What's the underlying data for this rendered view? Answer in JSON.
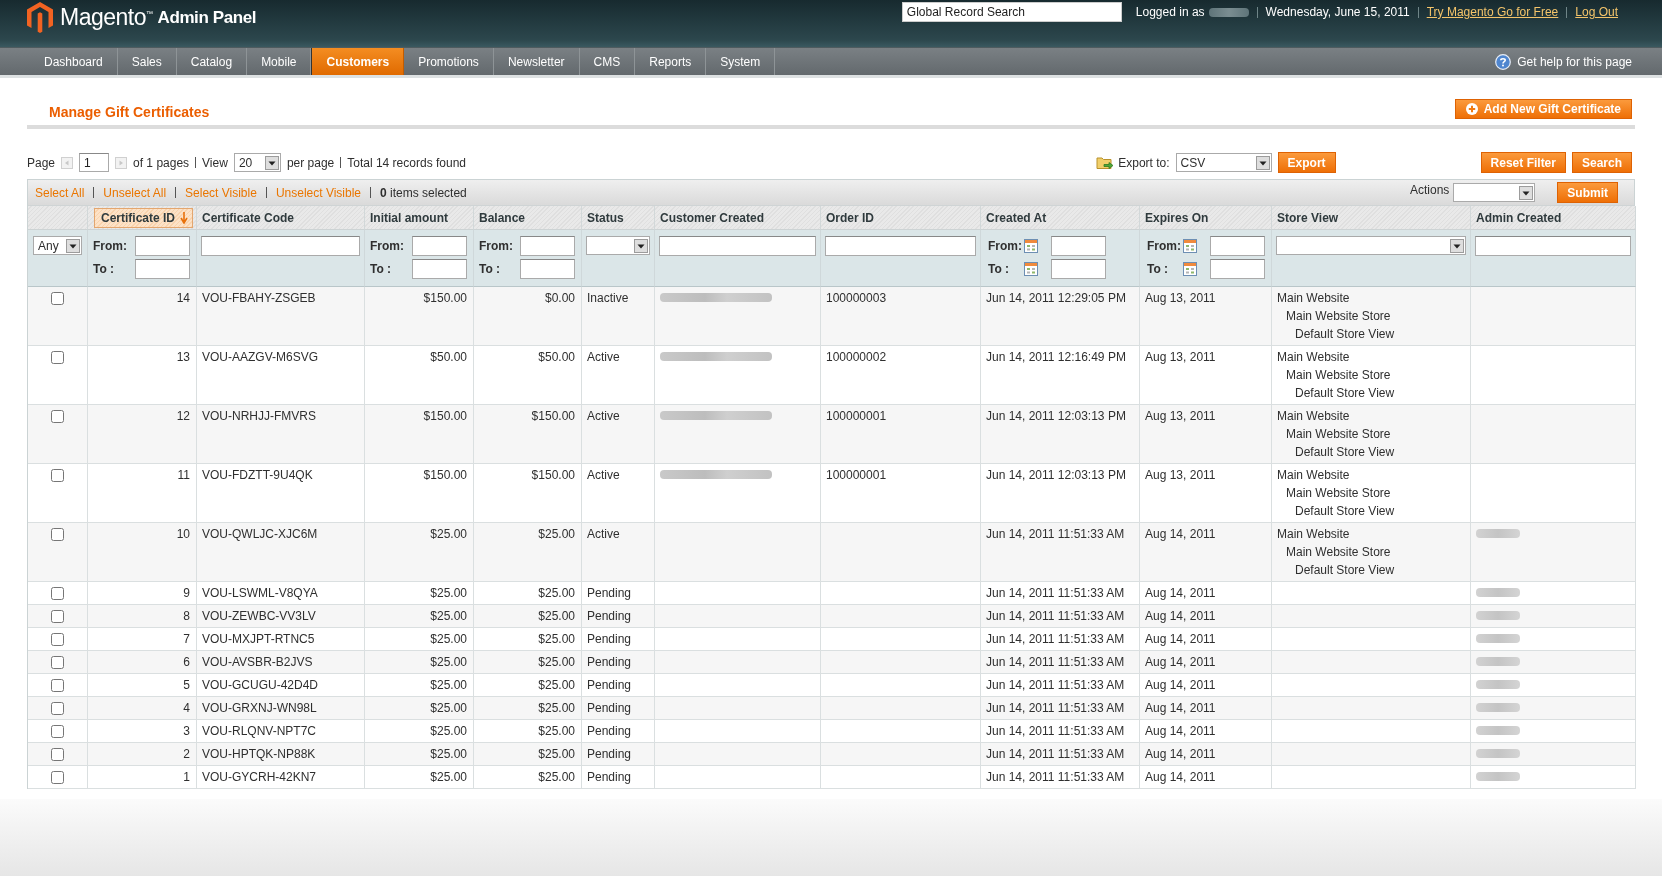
{
  "header": {
    "logo": "Magento$^{™}$",
    "subtitle": "Admin Panel",
    "search": {
      "value": "Global Record Search"
    },
    "logged_in_label": "Logged in as",
    "user_blurred": true,
    "date": "Wednesday, June 15, 2011",
    "links": [
      "Try Magento Go for Free",
      "Log Out"
    ]
  },
  "nav": {
    "items": [
      {
        "label": "Dashboard",
        "selected": false
      },
      {
        "label": "Sales",
        "selected": false
      },
      {
        "label": "Catalog",
        "selected": false
      },
      {
        "label": "Mobile",
        "selected": false
      },
      {
        "label": "Customers",
        "selected": true
      },
      {
        "label": "Promotions",
        "selected": false
      },
      {
        "label": "Newsletter",
        "selected": false
      },
      {
        "label": "CMS",
        "selected": false
      },
      {
        "label": "Reports",
        "selected": false
      },
      {
        "label": "System",
        "selected": false
      }
    ],
    "help": "Get help for this page"
  },
  "page": {
    "title": "Manage Gift Certificates",
    "add_button": "Add New Gift Certificate"
  },
  "pager": {
    "page_label": "Page",
    "page": "1",
    "of_pages": "of 1 pages",
    "view_label": "View",
    "per_page": "20",
    "per_page_label": "per page",
    "total": "Total 14 records found"
  },
  "export": {
    "label": "Export to:",
    "format": "CSV",
    "button": "Export"
  },
  "filter_buttons": [
    "Reset Filter",
    "Search"
  ],
  "massaction": {
    "links": [
      "Select All",
      "Unselect All",
      "Select Visible",
      "Unselect Visible"
    ],
    "count": "**0** items selected",
    "actions_label": "Actions",
    "submit": "Submit"
  },
  "table": {
    "columns": [
      {
        "filter": {
          "kind": "select",
          "value": "Any"
        }
      },
      {
        "label": "Certificate ID",
        "sorted": true,
        "filter": {
          "kind": "range",
          "from_label": "From:",
          "to_label": "To :"
        }
      },
      {
        "label": "Certificate Code",
        "sorted": false,
        "filter": {
          "kind": "text"
        }
      },
      {
        "label": "Initial amount",
        "sorted": false,
        "filter": {
          "kind": "range",
          "from_label": "From:",
          "to_label": "To :"
        }
      },
      {
        "label": "Balance",
        "sorted": false,
        "filter": {
          "kind": "range",
          "from_label": "From:",
          "to_label": "To :"
        }
      },
      {
        "label": "Status",
        "sorted": false,
        "filter": {
          "kind": "select"
        }
      },
      {
        "label": "Customer Created",
        "sorted": false,
        "filter": {
          "kind": "text"
        }
      },
      {
        "label": "Order ID",
        "sorted": false,
        "filter": {
          "kind": "text"
        }
      },
      {
        "label": "Created At",
        "sorted": false,
        "filter": {
          "kind": "date_range",
          "from_label": "From:",
          "to_label": "To :"
        }
      },
      {
        "label": "Expires On",
        "sorted": false,
        "filter": {
          "kind": "date_range",
          "from_label": "From:",
          "to_label": "To :"
        }
      },
      {
        "label": "Store View",
        "sorted": false,
        "filter": {
          "kind": "select"
        }
      },
      {
        "label": "Admin Created",
        "sorted": false,
        "filter": {
          "kind": "text"
        }
      }
    ],
    "rows": [
      {
        "checked": false,
        "id": "14",
        "code": "VOU-FBAHY-ZSGEB",
        "initial": "$150.00",
        "balance": "$0.00",
        "status": "Inactive",
        "customer_blurred": true,
        "order_id": "100000003",
        "created_at": "Jun 14, 2011 12:29:05 PM",
        "expires_on": "Aug 13, 2011",
        "store_view": [
          {
            "label": "Main Website",
            "children": [
              {
                "label": "Main Website Store",
                "children": [
                  {
                    "label": "Default Store View"
                  }
                ]
              }
            ]
          }
        ],
        "admin_blurred": false
      },
      {
        "checked": false,
        "id": "13",
        "code": "VOU-AAZGV-M6SVG",
        "initial": "$50.00",
        "balance": "$50.00",
        "status": "Active",
        "customer_blurred": true,
        "order_id": "100000002",
        "created_at": "Jun 14, 2011 12:16:49 PM",
        "expires_on": "Aug 13, 2011",
        "store_view": [
          {
            "label": "Main Website",
            "children": [
              {
                "label": "Main Website Store",
                "children": [
                  {
                    "label": "Default Store View"
                  }
                ]
              }
            ]
          }
        ],
        "admin_blurred": false
      },
      {
        "checked": false,
        "id": "12",
        "code": "VOU-NRHJJ-FMVRS",
        "initial": "$150.00",
        "balance": "$150.00",
        "status": "Active",
        "customer_blurred": true,
        "order_id": "100000001",
        "created_at": "Jun 14, 2011 12:03:13 PM",
        "expires_on": "Aug 13, 2011",
        "store_view": [
          {
            "label": "Main Website",
            "children": [
              {
                "label": "Main Website Store",
                "children": [
                  {
                    "label": "Default Store View"
                  }
                ]
              }
            ]
          }
        ],
        "admin_blurred": false
      },
      {
        "checked": false,
        "id": "11",
        "code": "VOU-FDZTT-9U4QK",
        "initial": "$150.00",
        "balance": "$150.00",
        "status": "Active",
        "customer_blurred": true,
        "order_id": "100000001",
        "created_at": "Jun 14, 2011 12:03:13 PM",
        "expires_on": "Aug 13, 2011",
        "store_view": [
          {
            "label": "Main Website",
            "children": [
              {
                "label": "Main Website Store",
                "children": [
                  {
                    "label": "Default Store View"
                  }
                ]
              }
            ]
          }
        ],
        "admin_blurred": false
      },
      {
        "checked": false,
        "id": "10",
        "code": "VOU-QWLJC-XJC6M",
        "initial": "$25.00",
        "balance": "$25.00",
        "status": "Active",
        "customer_blurred": false,
        "created_at": "Jun 14, 2011 11:51:33 AM",
        "expires_on": "Aug 14, 2011",
        "store_view": [
          {
            "label": "Main Website",
            "children": [
              {
                "label": "Main Website Store",
                "children": [
                  {
                    "label": "Default Store View"
                  }
                ]
              }
            ]
          }
        ],
        "admin_blurred": true
      },
      {
        "checked": false,
        "id": "9",
        "code": "VOU-LSWML-V8QYA",
        "initial": "$25.00",
        "balance": "$25.00",
        "status": "Pending",
        "customer_blurred": false,
        "created_at": "Jun 14, 2011 11:51:33 AM",
        "expires_on": "Aug 14, 2011",
        "admin_blurred": true
      },
      {
        "checked": false,
        "id": "8",
        "code": "VOU-ZEWBC-VV3LV",
        "initial": "$25.00",
        "balance": "$25.00",
        "status": "Pending",
        "customer_blurred": false,
        "created_at": "Jun 14, 2011 11:51:33 AM",
        "expires_on": "Aug 14, 2011",
        "admin_blurred": true
      },
      {
        "checked": false,
        "id": "7",
        "code": "VOU-MXJPT-RTNC5",
        "initial": "$25.00",
        "balance": "$25.00",
        "status": "Pending",
        "customer_blurred": false,
        "created_at": "Jun 14, 2011 11:51:33 AM",
        "expires_on": "Aug 14, 2011",
        "admin_blurred": true
      },
      {
        "checked": false,
        "id": "6",
        "code": "VOU-AVSBR-B2JVS",
        "initial": "$25.00",
        "balance": "$25.00",
        "status": "Pending",
        "customer_blurred": false,
        "created_at": "Jun 14, 2011 11:51:33 AM",
        "expires_on": "Aug 14, 2011",
        "admin_blurred": true
      },
      {
        "checked": false,
        "id": "5",
        "code": "VOU-GCUGU-42D4D",
        "initial": "$25.00",
        "balance": "$25.00",
        "status": "Pending",
        "customer_blurred": false,
        "created_at": "Jun 14, 2011 11:51:33 AM",
        "expires_on": "Aug 14, 2011",
        "admin_blurred": true
      },
      {
        "checked": false,
        "id": "4",
        "code": "VOU-GRXNJ-WN98L",
        "initial": "$25.00",
        "balance": "$25.00",
        "status": "Pending",
        "customer_blurred": false,
        "created_at": "Jun 14, 2011 11:51:33 AM",
        "expires_on": "Aug 14, 2011",
        "admin_blurred": true
      },
      {
        "checked": false,
        "id": "3",
        "code": "VOU-RLQNV-NPT7C",
        "initial": "$25.00",
        "balance": "$25.00",
        "status": "Pending",
        "customer_blurred": false,
        "created_at": "Jun 14, 2011 11:51:33 AM",
        "expires_on": "Aug 14, 2011",
        "admin_blurred": true
      },
      {
        "checked": false,
        "id": "2",
        "code": "VOU-HPTQK-NP88K",
        "initial": "$25.00",
        "balance": "$25.00",
        "status": "Pending",
        "customer_blurred": false,
        "created_at": "Jun 14, 2011 11:51:33 AM",
        "expires_on": "Aug 14, 2011",
        "admin_blurred": true
      },
      {
        "checked": false,
        "id": "1",
        "code": "VOU-GYCRH-42KN7",
        "initial": "$25.00",
        "balance": "$25.00",
        "status": "Pending",
        "customer_blurred": false,
        "created_at": "Jun 14, 2011 11:51:33 AM",
        "expires_on": "Aug 14, 2011",
        "admin_blurred": true
      }
    ]
  }
}
